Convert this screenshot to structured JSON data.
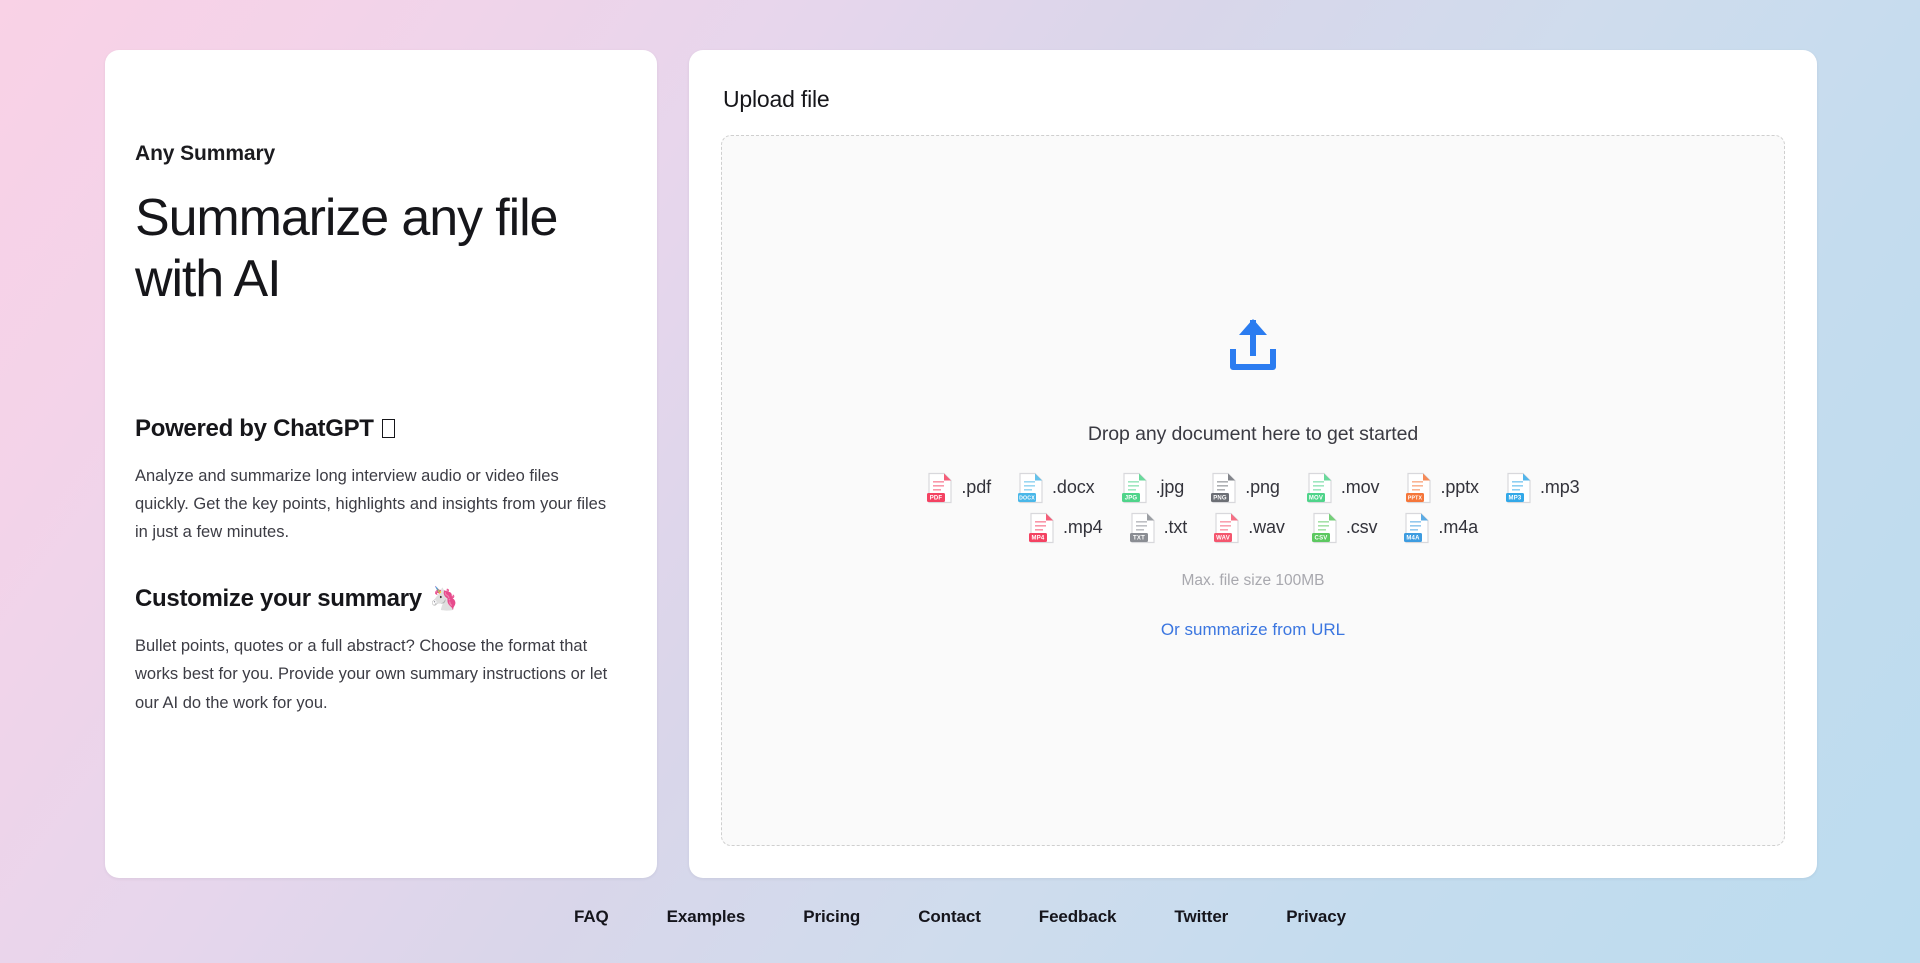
{
  "background": {
    "gradient_from": "#f9d2e6",
    "gradient_mid": "#d9d6ea",
    "gradient_to": "#bcdcef"
  },
  "left_panel": {
    "brand": "Any Summary",
    "headline": "Summarize any file with AI",
    "features": [
      {
        "title": "Powered by ChatGPT",
        "emoji": "",
        "emoji_name": "missing-glyph-box",
        "body": "Analyze and summarize long interview audio or video files quickly. Get the key points, highlights and insights from your files in just a few minutes."
      },
      {
        "title": "Customize your summary",
        "emoji": "🦄",
        "emoji_name": "unicorn-emoji",
        "body": "Bullet points, quotes or a full abstract? Choose the format that works best for you. Provide your own summary instructions or let our AI do the work for you."
      }
    ]
  },
  "upload_panel": {
    "title": "Upload file",
    "drop_text": "Drop any document here to get started",
    "max_size": "Max. file size 100MB",
    "url_link": "Or summarize from URL",
    "upload_icon_color": "#2b7cf0",
    "link_color": "#3b76e0",
    "file_types_row1": [
      {
        "label": ".pdf",
        "color": "#f44262",
        "badge": "PDF"
      },
      {
        "label": ".docx",
        "color": "#49b7e8",
        "badge": "DOCX"
      },
      {
        "label": ".jpg",
        "color": "#4fd48a",
        "badge": "JPG"
      },
      {
        "label": ".png",
        "color": "#6c6f75",
        "badge": "PNG"
      },
      {
        "label": ".mov",
        "color": "#4fd48a",
        "badge": "MOV"
      },
      {
        "label": ".pptx",
        "color": "#f5763a",
        "badge": "PPTX"
      },
      {
        "label": ".mp3",
        "color": "#32a8e8",
        "badge": "MP3"
      }
    ],
    "file_types_row2": [
      {
        "label": ".mp4",
        "color": "#f44262",
        "badge": "MP4"
      },
      {
        "label": ".txt",
        "color": "#8a8d93",
        "badge": "TXT"
      },
      {
        "label": ".wav",
        "color": "#f4566e",
        "badge": "WAV"
      },
      {
        "label": ".csv",
        "color": "#5cc860",
        "badge": "CSV"
      },
      {
        "label": ".m4a",
        "color": "#3d9ce0",
        "badge": "M4A"
      }
    ]
  },
  "footer": {
    "links": [
      "FAQ",
      "Examples",
      "Pricing",
      "Contact",
      "Feedback",
      "Twitter",
      "Privacy"
    ]
  }
}
